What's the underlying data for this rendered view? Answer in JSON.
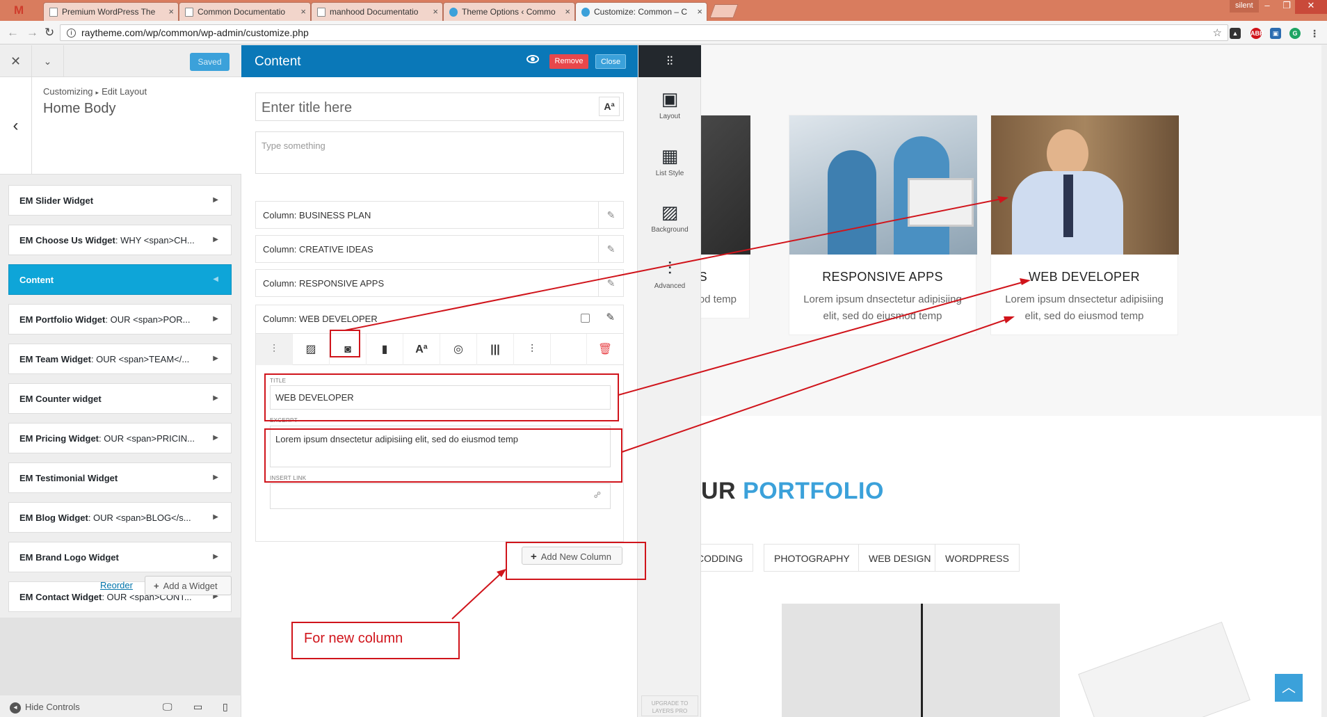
{
  "browser": {
    "tabs": [
      {
        "label": "Premium WordPress The"
      },
      {
        "label": "Common Documentatio"
      },
      {
        "label": "manhood Documentatio"
      },
      {
        "label": "Theme Options ‹ Commo"
      },
      {
        "label": "Customize: Common – C"
      }
    ],
    "user": "silent",
    "url": "raytheme.com/wp/common/wp-admin/customize.php"
  },
  "customizer": {
    "saved_label": "Saved",
    "breadcrumb_root": "Customizing",
    "breadcrumb_section": "Edit Layout",
    "title": "Home Body",
    "widgets": [
      {
        "title": "EM Slider Widget",
        "detail": ""
      },
      {
        "title": "EM Choose Us Widget",
        "detail": ": WHY <span>CH..."
      },
      {
        "title": "Content",
        "detail": ""
      },
      {
        "title": "EM Portfolio Widget",
        "detail": ": OUR <span>POR..."
      },
      {
        "title": "EM Team Widget",
        "detail": ": OUR <span>TEAM</..."
      },
      {
        "title": "EM Counter widget",
        "detail": ""
      },
      {
        "title": "EM Pricing Widget",
        "detail": ": OUR <span>PRICIN..."
      },
      {
        "title": "EM Testimonial Widget",
        "detail": ""
      },
      {
        "title": "EM Blog Widget",
        "detail": ": OUR <span>BLOG</s..."
      },
      {
        "title": "EM Brand Logo Widget",
        "detail": ""
      },
      {
        "title": "EM Contact Widget",
        "detail": ": OUR <span>CONT..."
      }
    ],
    "reorder_label": "Reorder",
    "add_widget_label": "Add a Widget",
    "hide_controls_label": "Hide Controls"
  },
  "panel": {
    "title": "Content",
    "remove_label": "Remove",
    "close_label": "Close",
    "title_placeholder": "Enter title here",
    "body_placeholder": "Type something",
    "columns": [
      {
        "label": "Column: BUSINESS PLAN"
      },
      {
        "label": "Column: CREATIVE IDEAS"
      },
      {
        "label": "Column: RESPONSIVE APPS"
      },
      {
        "label": "Column: WEB DEVELOPER"
      }
    ],
    "field_title_label": "TITLE",
    "field_title_value": "WEB DEVELOPER",
    "field_excerpt_label": "EXCERPT",
    "field_excerpt_value": "Lorem ipsum dnsectetur adipisiing elit, sed do eiusmod temp",
    "field_link_label": "INSERT LINK",
    "field_link_value": "",
    "add_column_label": "Add New Column"
  },
  "rail": {
    "items": [
      {
        "label": "Layout",
        "icon": "layout-icon"
      },
      {
        "label": "List Style",
        "icon": "list-style-icon"
      },
      {
        "label": "Background",
        "icon": "background-icon"
      },
      {
        "label": "Advanced",
        "icon": "advanced-icon"
      }
    ],
    "upgrade_label": "UPGRADE TO LAYERS PRO"
  },
  "site": {
    "cards": [
      {
        "title": "IDEAS",
        "text": "etur adipisiing mod temp"
      },
      {
        "title": "RESPONSIVE APPS",
        "text": "Lorem ipsum dnsectetur adipisiing elit, sed do eiusmod temp"
      },
      {
        "title": "WEB DEVELOPER",
        "text": "Lorem ipsum dnsectetur adipisiing elit, sed do eiusmod temp"
      }
    ],
    "portfolio_prefix": "UR",
    "portfolio_accent": "PORTFOLIO",
    "filters": [
      "CODDING",
      "PHOTOGRAPHY",
      "WEB DESIGN",
      "WORDPRESS"
    ]
  },
  "annotation": {
    "callout_text": "For new column"
  },
  "colors": {
    "accent": "#0ea5d8",
    "panel_header": "#0a78b8",
    "remove": "#e8474b",
    "annotation": "#d0141b"
  }
}
